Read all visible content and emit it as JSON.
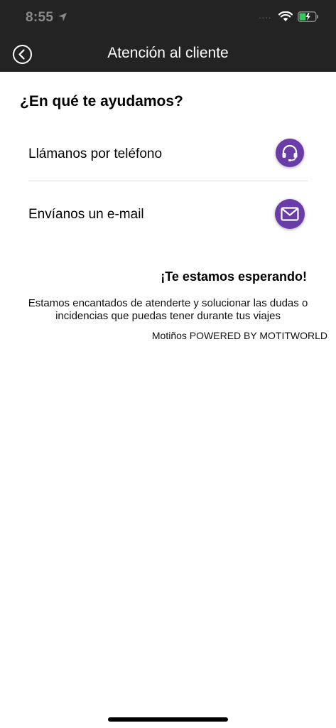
{
  "status_bar": {
    "time": "8:55",
    "signal_dots": "....",
    "icons": [
      "location-arrow-icon",
      "wifi-icon",
      "battery-charging-icon"
    ]
  },
  "nav": {
    "title": "Atención al cliente",
    "back_icon": "chevron-left-circle-icon"
  },
  "main": {
    "heading": "¿En qué te ayudamos?",
    "options": [
      {
        "label": "Llámanos por teléfono",
        "icon": "headset-icon"
      },
      {
        "label": "Envíanos un e-mail",
        "icon": "envelope-icon"
      }
    ],
    "waiting_title": "¡Te estamos esperando!",
    "description": "Estamos encantados de atenderte y solucionar las dudas o incidencias que puedas tener durante tus viajes",
    "powered_by": "Motiños POWERED BY MOTITWORLD"
  },
  "colors": {
    "header_bg": "#232323",
    "accent": "#6a3ca8",
    "battery": "#34c759"
  }
}
